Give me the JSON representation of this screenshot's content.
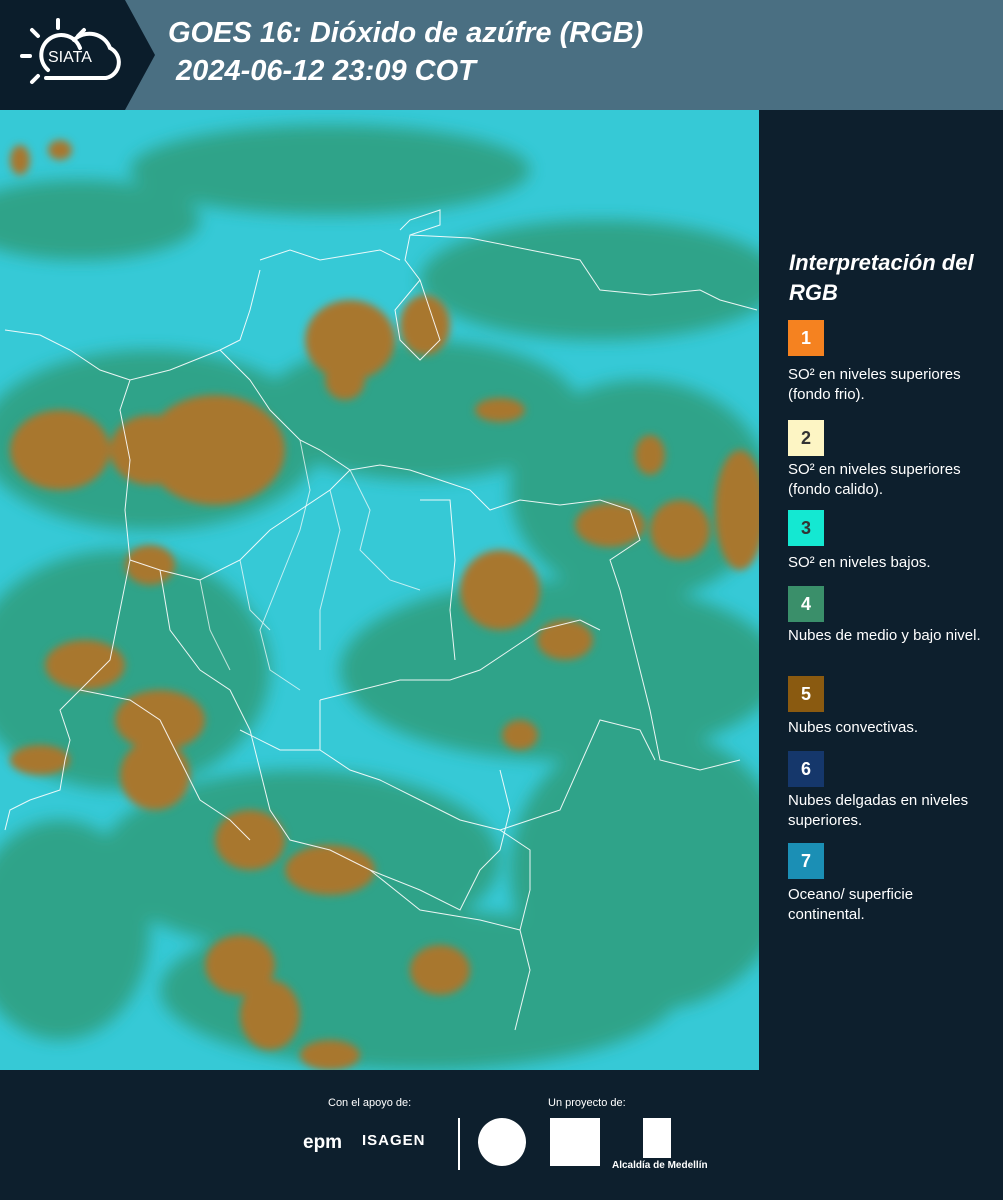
{
  "header": {
    "logo_text": "SIATA",
    "title_line1": "GOES 16: Dióxido de azúfre (RGB)",
    "title_line2": " 2024-06-12 23:09 COT",
    "background_color": "#4a6f82"
  },
  "legend": {
    "title": "Interpretación del RGB",
    "items": [
      {
        "number": "1",
        "color": "#f58220",
        "text_color": "#ffffff",
        "description": "SO² en niveles superiores (fondo frio)."
      },
      {
        "number": "2",
        "color": "#fdf5c4",
        "text_color": "#333333",
        "description": "SO² en niveles superiores (fondo calido)."
      },
      {
        "number": "3",
        "color": "#14e8d2",
        "text_color": "#333333",
        "description": "SO² en niveles bajos."
      },
      {
        "number": "4",
        "color": "#3a8f6a",
        "text_color": "#ffffff",
        "description": "Nubes de medio y bajo nivel."
      },
      {
        "number": "5",
        "color": "#8a5a10",
        "text_color": "#ffffff",
        "description": "Nubes convectivas."
      },
      {
        "number": "6",
        "color": "#15376b",
        "text_color": "#ffffff",
        "description": "Nubes delgadas en niveles superiores."
      },
      {
        "number": "7",
        "color": "#1b8fb5",
        "text_color": "#ffffff",
        "description": "Oceano/ superficie continental."
      }
    ]
  },
  "map": {
    "ocean_color": "#36c9d6",
    "cloud_green_color": "#2f9d7c",
    "convective_color": "#a8772e",
    "border_color": "#ffffff"
  },
  "footer": {
    "support_label": "Con el apoyo de:",
    "project_label": "Un proyecto de:",
    "sponsor1": "epm",
    "sponsor2": "ISAGEN",
    "partner_alcaldia": "Alcaldía de Medellín"
  }
}
